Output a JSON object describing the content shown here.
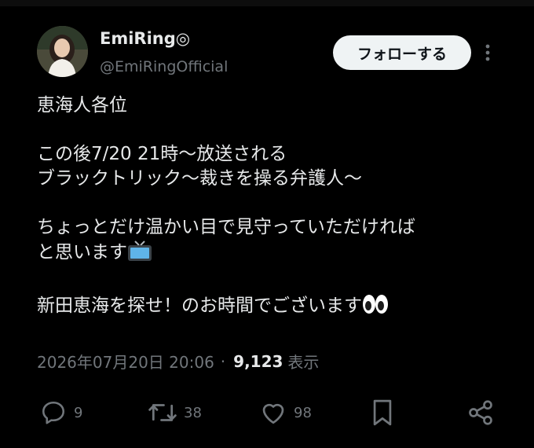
{
  "tweet": {
    "display_name": "EmiRing◎",
    "handle": "@EmiRingOfficial",
    "follow_label": "フォローする",
    "lines": {
      "l1": "恵海人各位",
      "l2": "この後7/20 21時〜放送される",
      "l3": "ブラックトリック〜裁きを操る弁護人〜",
      "l4": "ちょっとだけ温かい目で見守っていただければ",
      "l5": "と思います",
      "l6": "新田恵海を探せ！のお時間でございます"
    },
    "emojis": {
      "tv": "tv-icon",
      "eyes": "eyes-icon"
    },
    "timestamp": "2026年07月20日 20:06",
    "separator": "·",
    "views_count": "9,123",
    "views_label": "表示"
  },
  "actions": {
    "reply_count": "9",
    "repost_count": "38",
    "like_count": "98"
  },
  "colors": {
    "background": "#000000",
    "text": "#e7e9ea",
    "secondary": "#71767b",
    "follow_bg": "#eff3f4"
  }
}
